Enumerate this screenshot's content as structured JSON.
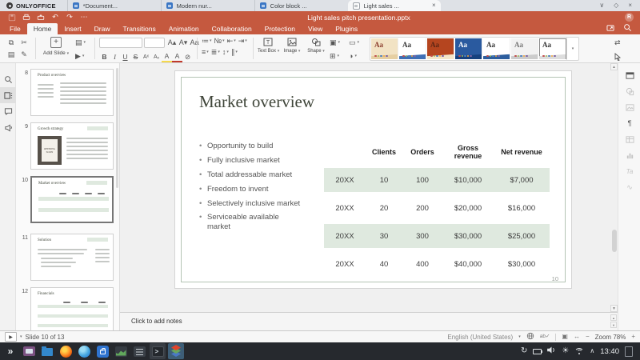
{
  "browser": {
    "logo_tab": "ONLYOFFICE",
    "tabs": [
      {
        "label": "*Document...",
        "active": false
      },
      {
        "label": "Modern nur...",
        "active": false
      },
      {
        "label": "Color block ...",
        "active": false
      },
      {
        "label": "Light sales ...",
        "active": true
      }
    ],
    "window_controls": {
      "min": "∨",
      "max": "◇",
      "close": "×"
    }
  },
  "titlebar": {
    "title": "Light sales pitch presentation.pptx",
    "avatar_initial": "R"
  },
  "icons": {
    "undo": "↶",
    "redo": "↷",
    "more": "⋯",
    "dropdown": "▾",
    "plus": "+",
    "replace": "⇄",
    "scroll_up": "▲",
    "scroll_down": "▼"
  },
  "menu": {
    "active_index": 1,
    "items": [
      "File",
      "Home",
      "Insert",
      "Draw",
      "Transitions",
      "Animation",
      "Collaboration",
      "Protection",
      "View",
      "Plugins"
    ]
  },
  "toolbar": {
    "add_slide_label": "Add Slide",
    "font_name_value": "",
    "font_size_value": "",
    "clipboard": [
      {
        "name": "copy",
        "glyph": "⧉"
      },
      {
        "name": "cut",
        "glyph": "✂"
      },
      {
        "name": "paste",
        "glyph": "▤"
      },
      {
        "name": "format-painter",
        "glyph": "✎"
      }
    ],
    "font_row": [
      {
        "name": "increase-font",
        "glyph": "A▴"
      },
      {
        "name": "decrease-font",
        "glyph": "A▾"
      },
      {
        "name": "change-case",
        "glyph": "Aa"
      }
    ],
    "format_row": [
      {
        "name": "bold",
        "glyph": "B"
      },
      {
        "name": "italic",
        "glyph": "I"
      },
      {
        "name": "underline",
        "glyph": "U"
      },
      {
        "name": "strikethrough",
        "glyph": "S"
      },
      {
        "name": "superscript",
        "glyph": "Aˣ"
      },
      {
        "name": "subscript",
        "glyph": "Aₓ"
      },
      {
        "name": "highlight-color",
        "glyph": "A"
      },
      {
        "name": "font-color",
        "glyph": "A"
      },
      {
        "name": "clear-style",
        "glyph": "⊘"
      }
    ],
    "layout_tools": [
      {
        "name": "change-layout",
        "glyph": "▤"
      },
      {
        "name": "reset-slide",
        "glyph": "▶"
      }
    ],
    "para_row1": [
      {
        "name": "bullet-list",
        "glyph": "≔"
      },
      {
        "name": "numbered-list",
        "glyph": "№"
      },
      {
        "name": "decrease-indent",
        "glyph": "⇤"
      },
      {
        "name": "increase-indent",
        "glyph": "⇥"
      }
    ],
    "para_row2": [
      {
        "name": "horizontal-align",
        "glyph": "≡"
      },
      {
        "name": "vertical-align",
        "glyph": "≣"
      },
      {
        "name": "line-spacing",
        "glyph": "↕"
      },
      {
        "name": "insert-columns",
        "glyph": "∥"
      }
    ],
    "insert_buttons": [
      {
        "name": "text-box",
        "label": "Text Box"
      },
      {
        "name": "image",
        "label": "Image"
      },
      {
        "name": "shape",
        "label": "Shape"
      }
    ],
    "arrange": [
      {
        "name": "arrange-shape",
        "glyph": "▣"
      },
      {
        "name": "align-shape",
        "glyph": "⊞"
      }
    ],
    "slide_tools": [
      {
        "name": "slide-size",
        "glyph": "▭"
      },
      {
        "name": "color-scheme",
        "glyph": "◑"
      }
    ],
    "theme_label": "Aa",
    "dot_colors": [
      "#c0504d",
      "#9bbb59",
      "#4f81bd",
      "#f2a640",
      "#8064a2"
    ],
    "themes": [
      {
        "bg": "#f2e3c4",
        "accent": "#e6cfa2",
        "fg": "#8a3c2c",
        "selected": false
      },
      {
        "bg": "#ffffff",
        "accent": "#3f6fb5",
        "fg": "#333333",
        "selected": false
      },
      {
        "bg": "#b5451f",
        "accent": "#f4e6c8",
        "fg": "#5c2514",
        "selected": false
      },
      {
        "bg": "#2a5a9f",
        "accent": "#16417e",
        "fg": "#ffffff",
        "selected": false
      },
      {
        "bg": "#ffffff",
        "accent": "#2d5e9e",
        "fg": "#333333",
        "selected": false
      },
      {
        "bg": "#f2f2f2",
        "accent": "#cccccc",
        "fg": "#777777",
        "selected": false
      },
      {
        "bg": "#ffffff",
        "accent": "#dddddd",
        "fg": "#333333",
        "selected": true
      }
    ]
  },
  "sidebar": {
    "slides": [
      {
        "number": "8",
        "title": "Product overview",
        "layout": "two-col",
        "selected": false
      },
      {
        "number": "9",
        "title": "Growth strategy",
        "layout": "image-left",
        "image_text": "OPENING SOON",
        "selected": false
      },
      {
        "number": "10",
        "title": "Market overview",
        "layout": "table",
        "selected": true
      },
      {
        "number": "11",
        "title": "Solution",
        "layout": "text",
        "selected": false
      },
      {
        "number": "12",
        "title": "Financials",
        "layout": "fin-table",
        "selected": false
      }
    ]
  },
  "slide": {
    "title": "Market overview",
    "bullets": [
      "Opportunity to build",
      "Fully inclusive market",
      "Total addressable market",
      "Freedom to invent",
      "Selectively inclusive market",
      "Serviceable available market"
    ],
    "page_number": "10",
    "table": {
      "headers": [
        "",
        "Clients",
        "Orders",
        "Gross revenue",
        "Net revenue"
      ],
      "rows": [
        [
          "20XX",
          "10",
          "100",
          "$10,000",
          "$7,000"
        ],
        [
          "20XX",
          "20",
          "200",
          "$20,000",
          "$16,000"
        ],
        [
          "20XX",
          "30",
          "300",
          "$30,000",
          "$25,000"
        ],
        [
          "20XX",
          "40",
          "400",
          "$40,000",
          "$30,000"
        ]
      ],
      "highlight_rows": [
        0,
        2
      ],
      "highlight_color": "#dfe9df"
    }
  },
  "notes": {
    "placeholder": "Click to add notes"
  },
  "statusbar": {
    "slide_indicator": "Slide 10 of 13",
    "language": "English (United States)",
    "spell_label": "ab✓",
    "zoom_label": "Zoom 78%",
    "zoom_out": "−",
    "zoom_in": "+"
  },
  "taskbar": {
    "time": "13:40",
    "apps": [
      {
        "name": "app-launcher",
        "active": false,
        "highlight": false
      },
      {
        "name": "media-app",
        "active": false,
        "highlight": false
      },
      {
        "name": "file-manager",
        "active": false,
        "highlight": false
      },
      {
        "name": "firefox",
        "active": false,
        "highlight": false
      },
      {
        "name": "web-browser",
        "active": false,
        "highlight": false
      },
      {
        "name": "app-store",
        "active": false,
        "highlight": false
      },
      {
        "name": "system-monitor",
        "active": false,
        "highlight": false
      },
      {
        "name": "settings",
        "active": false,
        "highlight": false
      },
      {
        "name": "terminal",
        "active": false,
        "highlight": true
      },
      {
        "name": "onlyoffice",
        "active": true,
        "highlight": false
      }
    ]
  }
}
